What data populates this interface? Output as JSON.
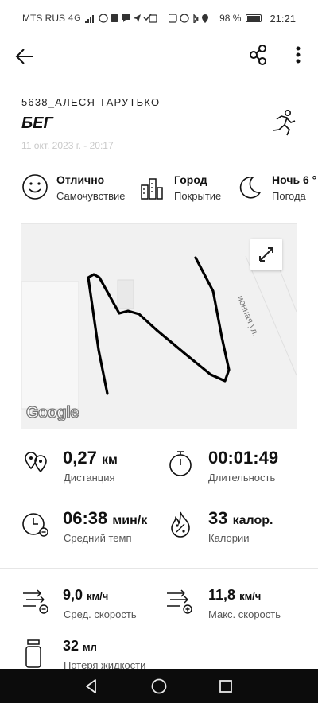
{
  "status_bar": {
    "carrier": "MTS RUS",
    "network": "4G",
    "battery": "98 %",
    "time": "21:21"
  },
  "app_bar": {
    "back_icon": "arrow-left-icon",
    "share_icon": "share-icon",
    "more_icon": "more-vertical-icon"
  },
  "activity": {
    "owner": "5638_АЛЕСЯ ТАРУТЬКО",
    "title": "БЕГ",
    "date": "11 окт. 2023 г. - 20:17",
    "type_icon": "running-person-icon"
  },
  "conditions": [
    {
      "value": "Отлично",
      "label": "Самочувствие",
      "icon": "smiley-face-icon"
    },
    {
      "value": "Город",
      "label": "Покрытие",
      "icon": "city-buildings-icon"
    },
    {
      "value": "Ночь 6 °",
      "label": "Погода",
      "icon": "moon-icon"
    }
  ],
  "map": {
    "street_label": "ионная ул.",
    "logo": "Google",
    "expand_icon": "expand-arrows-icon"
  },
  "metrics": {
    "distance": {
      "value": "0,27",
      "unit": "км",
      "label": "Дистанция",
      "icon": "distance-pins-icon"
    },
    "duration": {
      "value": "00:01:49",
      "label": "Длительность",
      "icon": "stopwatch-icon"
    },
    "pace": {
      "value": "06:38",
      "unit": "мин/к",
      "label": "Средний темп",
      "icon": "pace-clock-icon"
    },
    "calories": {
      "value": "33",
      "unit": "калор.",
      "label": "Калории",
      "icon": "flame-percent-icon"
    },
    "avg_speed": {
      "value": "9,0",
      "unit": "км/ч",
      "label": "Сред. скорость",
      "icon": "speed-minus-icon"
    },
    "max_speed": {
      "value": "11,8",
      "unit": "км/ч",
      "label": "Макс. скорость",
      "icon": "speed-plus-icon"
    },
    "fluid": {
      "value": "32",
      "unit": "мл",
      "label": "Потеря жидкости",
      "icon": "bottle-icon"
    }
  },
  "nav_bar": {
    "back_icon": "triangle-back-icon",
    "home_icon": "circle-home-icon",
    "recents_icon": "square-recents-icon"
  },
  "colors": {
    "background": "#ffffff",
    "text": "#111111",
    "secondary_text": "#555555",
    "map_background": "#f1f1f1",
    "route": "#000000",
    "nav_bar": "#0c0c0c"
  }
}
